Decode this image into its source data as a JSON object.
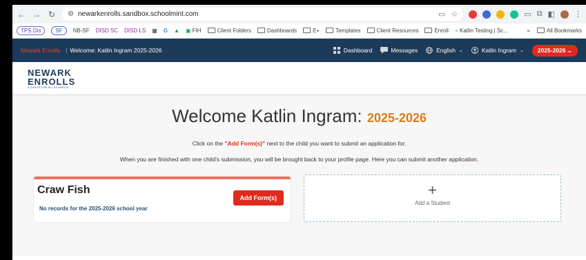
{
  "browser": {
    "url": "newarkenrolls.sandbox.schoolmint.com",
    "extensions": [
      {
        "name": "new-badge-icon",
        "color": "#e53935"
      },
      {
        "name": "extension-blue-icon",
        "color": "#3f6ad8"
      },
      {
        "name": "pencil-extension-icon",
        "color": "#f4b400"
      },
      {
        "name": "grammarly-icon",
        "color": "#15c39a"
      }
    ]
  },
  "bookmarks": {
    "items": [
      "TPS Dis",
      "SF",
      "NB-SF",
      "DISD SC",
      "DISD LS",
      "G",
      "FIH",
      "Client Folders",
      "Dashboards",
      "E+",
      "Templates",
      "Client Resources",
      "Enroll",
      "Katlin Testing | Sc..."
    ],
    "more": "»",
    "all": "All Bookmarks"
  },
  "header": {
    "brand": "Newark Enrolls",
    "separator": "|",
    "welcome": "Welcome: Katlin Ingram 2025-2026",
    "dashboard": "Dashboard",
    "messages": "Messages",
    "language": "English",
    "user": "Katlin Ingram",
    "year": "2025-2026"
  },
  "logo": {
    "line1": "NEWARK",
    "line2": "ENROLLS",
    "tagline": "A CHOICE FOR ALL STUDENTS"
  },
  "main": {
    "welcome_prefix": "Welcome Katlin Ingram:",
    "welcome_year": "2025-2026",
    "instruction1_before": "Click on the ",
    "instruction1_highlight": "\"Add Form(s)\"",
    "instruction1_after": " next to the child you want to submit an application for.",
    "instruction2": "When you are finished with one child's submission, you will be brought back to your profile page. Here you can submit another application."
  },
  "student_card": {
    "name": "Craw Fish",
    "note": "No records for the 2025-2026 school year",
    "button": "Add Form(s)"
  },
  "add_student": {
    "plus": "+",
    "label": "Add a Student"
  },
  "colors": {
    "header_bg": "#1c3a5a",
    "accent_red": "#e02a1e",
    "year_orange": "#e07b16"
  }
}
